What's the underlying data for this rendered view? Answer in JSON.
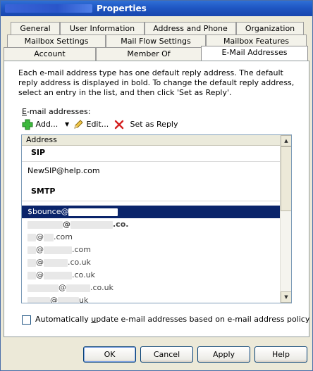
{
  "window": {
    "title": "Properties"
  },
  "tabs": {
    "row1": [
      "General",
      "User Information",
      "Address and Phone",
      "Organization"
    ],
    "row2": [
      "Mailbox Settings",
      "Mail Flow Settings",
      "Mailbox Features"
    ],
    "row3": [
      "Account",
      "Member Of",
      "E-Mail Addresses"
    ],
    "selected": "E-Mail Addresses"
  },
  "panel": {
    "description": "Each e-mail address type has one default reply address. The default reply address is displayed in bold. To change the default reply address, select an entry in the list, and then click 'Set as Reply'.",
    "list_label": "E-mail addresses:",
    "toolbar": {
      "add_label": "Add...",
      "edit_label": "Edit...",
      "set_reply_label": "Set as Reply"
    },
    "list": {
      "column_header": "Address",
      "groups": [
        {
          "name": "SIP",
          "items": [
            "NewSIP@help.com"
          ]
        },
        {
          "name": "SMTP",
          "items": [
            "$bounce@",
            "@",
            "@",
            "@",
            "@",
            "@",
            "@",
            "@"
          ]
        }
      ],
      "partial_suffixes": [
        "",
        ".co.",
        ".com",
        ".com",
        ".co.uk",
        ".co.uk",
        ".co.uk",
        "uk"
      ]
    },
    "auto_update_label": "Automatically update e-mail addresses based on e-mail address policy",
    "auto_update_checked": false
  },
  "buttons": {
    "ok": "OK",
    "cancel": "Cancel",
    "apply": "Apply",
    "help": "Help"
  }
}
